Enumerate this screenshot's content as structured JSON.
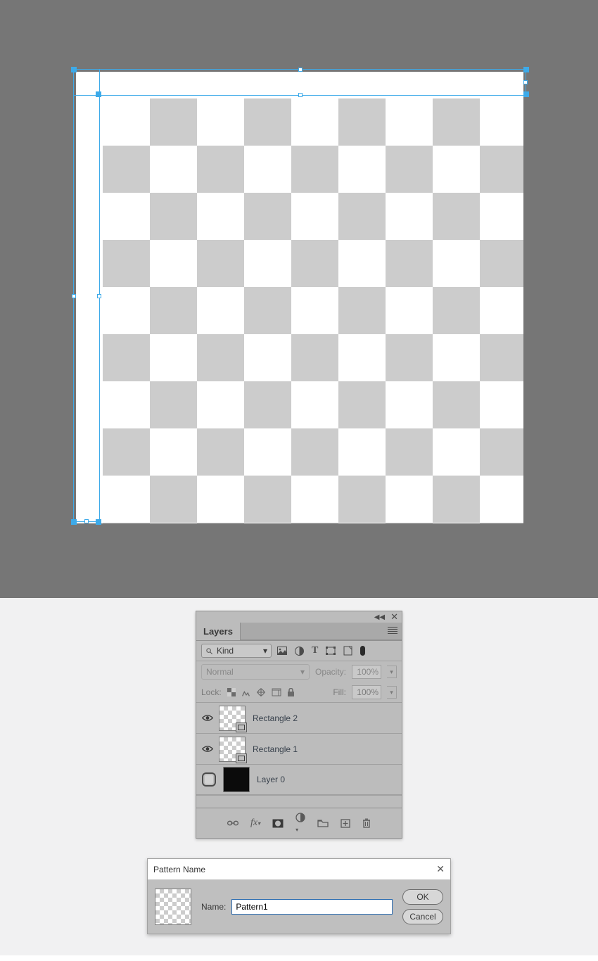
{
  "layers_panel": {
    "title": "Layers",
    "filter_label": "Kind",
    "blend_mode": "Normal",
    "opacity_label": "Opacity:",
    "opacity_value": "100%",
    "lock_label": "Lock:",
    "fill_label": "Fill:",
    "fill_value": "100%",
    "layers": [
      {
        "name": "Rectangle 2",
        "visible": true,
        "thumb": "checker",
        "vector": true
      },
      {
        "name": "Rectangle 1",
        "visible": true,
        "thumb": "checker",
        "vector": true
      },
      {
        "name": "Layer 0",
        "visible": false,
        "thumb": "black",
        "vector": false
      }
    ]
  },
  "pattern_dialog": {
    "title": "Pattern Name",
    "name_label": "Name:",
    "name_value": "Pattern1",
    "ok_label": "OK",
    "cancel_label": "Cancel"
  }
}
